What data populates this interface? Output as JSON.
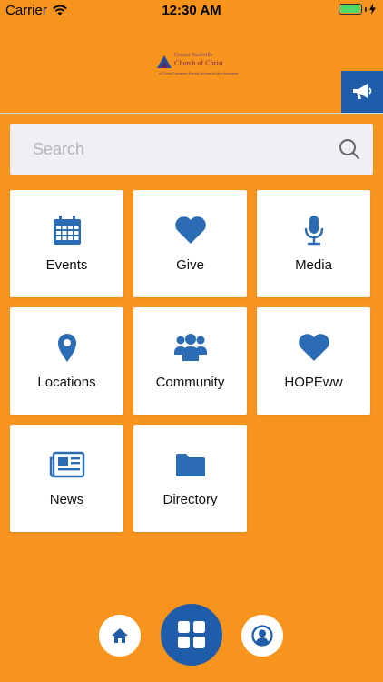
{
  "status_bar": {
    "carrier": "Carrier",
    "time": "12:30 AM"
  },
  "header": {
    "logo": {
      "line1": "Greater Nashville",
      "line2": "Church of Christ",
      "line3": "A Christ Centered Family Where All Are Welcome"
    },
    "announce_icon": "megaphone-icon"
  },
  "search": {
    "placeholder": "Search",
    "value": ""
  },
  "tiles": [
    {
      "label": "Events",
      "icon": "calendar-icon"
    },
    {
      "label": "Give",
      "icon": "heart-icon"
    },
    {
      "label": "Media",
      "icon": "microphone-icon"
    },
    {
      "label": "Locations",
      "icon": "map-pin-icon"
    },
    {
      "label": "Community",
      "icon": "group-icon"
    },
    {
      "label": "HOPEww",
      "icon": "heart-icon"
    },
    {
      "label": "News",
      "icon": "newspaper-icon"
    },
    {
      "label": "Directory",
      "icon": "folder-icon"
    }
  ],
  "bottom_nav": {
    "home_icon": "home-icon",
    "grid_icon": "grid-icon",
    "profile_icon": "user-circle-icon"
  },
  "colors": {
    "background": "#F7941D",
    "accent": "#1F5CA9",
    "icon": "#2B6CB5",
    "tile": "#FFFFFF",
    "search_bg": "#EFEFF4"
  }
}
